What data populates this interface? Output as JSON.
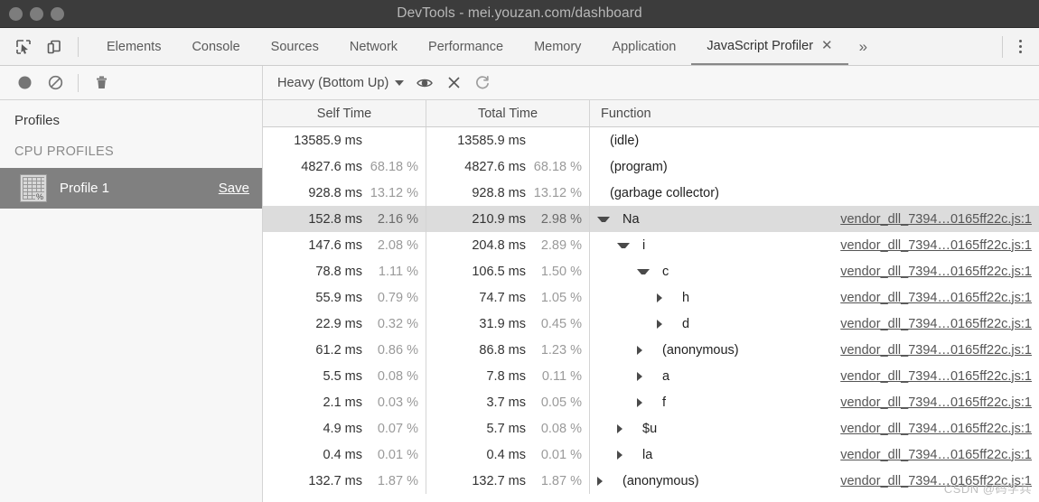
{
  "window": {
    "title": "DevTools - mei.youzan.com/dashboard",
    "traffic_lights": [
      "close",
      "minimize",
      "maximize"
    ]
  },
  "tabbar": {
    "inspect_icon": "inspect-element-icon",
    "device_icon": "device-toolbar-icon",
    "tabs": [
      {
        "label": "Elements",
        "active": false
      },
      {
        "label": "Console",
        "active": false
      },
      {
        "label": "Sources",
        "active": false
      },
      {
        "label": "Network",
        "active": false
      },
      {
        "label": "Performance",
        "active": false
      },
      {
        "label": "Memory",
        "active": false
      },
      {
        "label": "Application",
        "active": false
      },
      {
        "label": "JavaScript Profiler",
        "active": true,
        "closable": true
      }
    ],
    "close_glyph": "✕",
    "more_glyph": "»",
    "menu_icon": "kebab-menu-icon"
  },
  "toolbar": {
    "record_icon": "record-circle-icon",
    "clear_icon": "no-entry-icon",
    "trash_icon": "trash-icon",
    "view_mode": "Heavy (Bottom Up)",
    "eye_icon": "eye-icon",
    "close_glyph": "✕",
    "refresh_glyph": "↻"
  },
  "sidebar": {
    "title": "Profiles",
    "group_label": "CPU PROFILES",
    "profile": {
      "icon": "profile-grid-percent-icon",
      "icon_badge": "%",
      "name": "Profile 1",
      "save_label": "Save",
      "selected": true
    }
  },
  "table": {
    "columns": [
      "Self Time",
      "Total Time",
      "Function"
    ],
    "rows": [
      {
        "self_ms": "13585.9 ms",
        "self_pct": "",
        "total_ms": "13585.9 ms",
        "total_pct": "",
        "function": "(idle)",
        "depth": 0,
        "state": "none",
        "link": "",
        "selected": false
      },
      {
        "self_ms": "4827.6 ms",
        "self_pct": "68.18 %",
        "total_ms": "4827.6 ms",
        "total_pct": "68.18 %",
        "function": "(program)",
        "depth": 0,
        "state": "none",
        "link": "",
        "selected": false
      },
      {
        "self_ms": "928.8 ms",
        "self_pct": "13.12 %",
        "total_ms": "928.8 ms",
        "total_pct": "13.12 %",
        "function": "(garbage collector)",
        "depth": 0,
        "state": "none",
        "link": "",
        "selected": false
      },
      {
        "self_ms": "152.8 ms",
        "self_pct": "2.16 %",
        "total_ms": "210.9 ms",
        "total_pct": "2.98 %",
        "function": "Na",
        "depth": 0,
        "state": "expanded",
        "link": "vendor_dll_7394…0165ff22c.js:1",
        "selected": true
      },
      {
        "self_ms": "147.6 ms",
        "self_pct": "2.08 %",
        "total_ms": "204.8 ms",
        "total_pct": "2.89 %",
        "function": "i",
        "depth": 1,
        "state": "expanded",
        "link": "vendor_dll_7394…0165ff22c.js:1",
        "selected": false
      },
      {
        "self_ms": "78.8 ms",
        "self_pct": "1.11 %",
        "total_ms": "106.5 ms",
        "total_pct": "1.50 %",
        "function": "c",
        "depth": 2,
        "state": "expanded",
        "link": "vendor_dll_7394…0165ff22c.js:1",
        "selected": false
      },
      {
        "self_ms": "55.9 ms",
        "self_pct": "0.79 %",
        "total_ms": "74.7 ms",
        "total_pct": "1.05 %",
        "function": "h",
        "depth": 3,
        "state": "collapsed",
        "link": "vendor_dll_7394…0165ff22c.js:1",
        "selected": false
      },
      {
        "self_ms": "22.9 ms",
        "self_pct": "0.32 %",
        "total_ms": "31.9 ms",
        "total_pct": "0.45 %",
        "function": "d",
        "depth": 3,
        "state": "collapsed",
        "link": "vendor_dll_7394…0165ff22c.js:1",
        "selected": false
      },
      {
        "self_ms": "61.2 ms",
        "self_pct": "0.86 %",
        "total_ms": "86.8 ms",
        "total_pct": "1.23 %",
        "function": "(anonymous)",
        "depth": 2,
        "state": "collapsed",
        "link": "vendor_dll_7394…0165ff22c.js:1",
        "selected": false
      },
      {
        "self_ms": "5.5 ms",
        "self_pct": "0.08 %",
        "total_ms": "7.8 ms",
        "total_pct": "0.11 %",
        "function": "a",
        "depth": 2,
        "state": "collapsed",
        "link": "vendor_dll_7394…0165ff22c.js:1",
        "selected": false
      },
      {
        "self_ms": "2.1 ms",
        "self_pct": "0.03 %",
        "total_ms": "3.7 ms",
        "total_pct": "0.05 %",
        "function": "f",
        "depth": 2,
        "state": "collapsed",
        "link": "vendor_dll_7394…0165ff22c.js:1",
        "selected": false
      },
      {
        "self_ms": "4.9 ms",
        "self_pct": "0.07 %",
        "total_ms": "5.7 ms",
        "total_pct": "0.08 %",
        "function": "$u",
        "depth": 1,
        "state": "collapsed",
        "link": "vendor_dll_7394…0165ff22c.js:1",
        "selected": false
      },
      {
        "self_ms": "0.4 ms",
        "self_pct": "0.01 %",
        "total_ms": "0.4 ms",
        "total_pct": "0.01 %",
        "function": "la",
        "depth": 1,
        "state": "collapsed",
        "link": "vendor_dll_7394…0165ff22c.js:1",
        "selected": false
      },
      {
        "self_ms": "132.7 ms",
        "self_pct": "1.87 %",
        "total_ms": "132.7 ms",
        "total_pct": "1.87 %",
        "function": "(anonymous)",
        "depth": 0,
        "state": "collapsed",
        "link": "vendor_dll_7394…0165ff22c.js:1",
        "selected": false
      }
    ]
  },
  "watermark": "CSDN @码学兵",
  "colors": {
    "titlebar_bg": "#3c3c3c",
    "tabbar_bg": "#f3f3f3",
    "toolbar_bg": "#f7f7f7",
    "sidebar_bg": "#f7f7f7",
    "selection_bg": "#808080",
    "row_selected_bg": "#dcdcdc",
    "percent_text": "#9a9a9a",
    "link_text": "#555555"
  }
}
